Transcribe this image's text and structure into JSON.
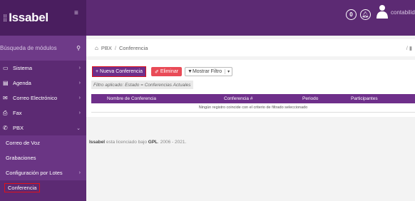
{
  "app": {
    "brand": "Issabel",
    "logo_glyph": "⁞⁞",
    "menu_icon": "≡"
  },
  "topbar": {
    "notification_count": "0",
    "username": "contabilida"
  },
  "sidebar": {
    "search_placeholder": "Búsqueda de módulos",
    "items": [
      {
        "label": "Sistema",
        "icon": "monitor-icon"
      },
      {
        "label": "Agenda",
        "icon": "book-icon"
      },
      {
        "label": "Correo Electrónico",
        "icon": "envelope-icon"
      },
      {
        "label": "Fax",
        "icon": "printer-icon"
      },
      {
        "label": "PBX",
        "icon": "phone-icon"
      }
    ],
    "sub_items": [
      {
        "label": "Correo de Voz"
      },
      {
        "label": "Grabaciones"
      },
      {
        "label": "Configuración por Lotes"
      },
      {
        "label": "Conferencia"
      }
    ]
  },
  "breadcrumb": {
    "root": "PBX",
    "current": "Conferencia",
    "separator": "/"
  },
  "toolbar": {
    "new_label": "+ Nueva Conferencia",
    "delete_label": "Eliminar",
    "filter_label": "Mostrar Filtro"
  },
  "filter": {
    "applied_text": "Filtro aplicado: Estado = Conferencias Actuales"
  },
  "table": {
    "columns": [
      "Nombre de Conferencia",
      "Conferencia #",
      "Periodo",
      "Participantes"
    ],
    "empty_message": "Ningún registro coincide con el criterio de filtrado seleccionado"
  },
  "footer": {
    "product": "Issabel",
    "text_1": " esta licenciado bajo ",
    "license": "GPL",
    "text_2": ". 2006 - 2021."
  },
  "colors": {
    "brand_purple": "#5c2a73",
    "table_header": "#6e2f8a",
    "delete_red": "#e94b57",
    "highlight_red": "#e0101a"
  }
}
